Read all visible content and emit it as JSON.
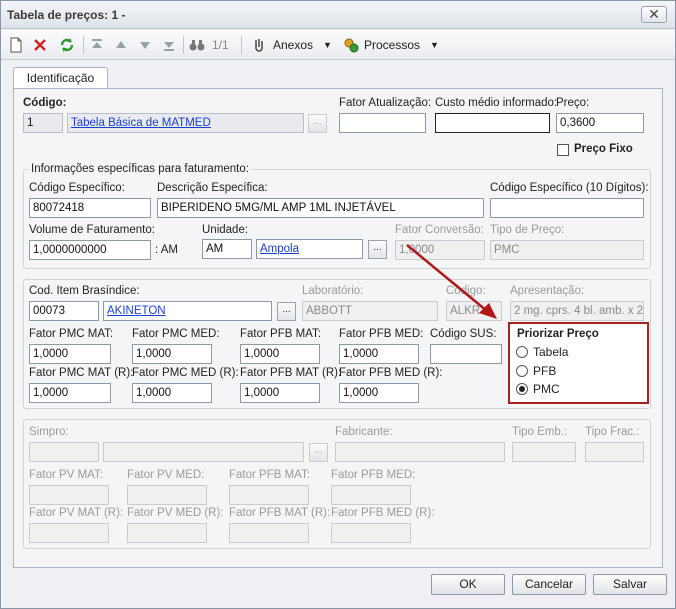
{
  "window": {
    "title": "Tabela de preços: 1 -",
    "close_glyph": "✕"
  },
  "toolbar": {
    "pager": "1/1",
    "anexos": "Anexos",
    "processos": "Processos"
  },
  "tabs": [
    {
      "label": "Identificação"
    }
  ],
  "form": {
    "codigo": {
      "label": "Código:",
      "value": "1",
      "desc": "Tabela Básica de MATMED"
    },
    "fator_atualizacao": {
      "label": "Fator Atualização:",
      "value": ""
    },
    "custo_medio": {
      "label": "Custo médio informado:",
      "value": ""
    },
    "preco": {
      "label": "Preço:",
      "value": "0,3600"
    },
    "preco_fixo": {
      "label": "Preço Fixo",
      "checked": false
    }
  },
  "faturamento": {
    "title": "Informações específicas para faturamento:",
    "codigo_especifico": {
      "label": "Código Específico:",
      "value": "80072418"
    },
    "descricao_especifica": {
      "label": "Descrição Específica:",
      "value": "BIPERIDENO 5MG/ML AMP 1ML INJETÁVEL"
    },
    "codigo_10": {
      "label": "Código Específico (10 Dígitos):",
      "value": ""
    },
    "volume": {
      "label": "Volume de Faturamento:",
      "value": "1,0000000000",
      "suffix": ": AM"
    },
    "unidade": {
      "label": "Unidade:",
      "code": "AM",
      "desc": "Ampola"
    },
    "fator_conversao": {
      "label": "Fator Conversão:",
      "value": "1,0000"
    },
    "tipo_preco": {
      "label": "Tipo de Preço:",
      "value": "PMC"
    }
  },
  "brasindice": {
    "cod_item": {
      "label": "Cod. Item Brasíndice:",
      "code": "00073",
      "desc": "AKINETON"
    },
    "laboratorio": {
      "label": "Laboratório:",
      "value": "ABBOTT"
    },
    "codigo": {
      "label": "Código:",
      "value": "ALKR"
    },
    "apresentacao": {
      "label": "Apresentação:",
      "value": "2 mg. cprs. 4 bl. amb. x 20"
    },
    "row1_labels": [
      "Fator PMC MAT:",
      "Fator PMC MED:",
      "Fator PFB MAT:",
      "Fator PFB MED:",
      "Código SUS:"
    ],
    "row1_values": [
      "1,0000",
      "1,0000",
      "1,0000",
      "1,0000",
      ""
    ],
    "row2_labels": [
      "Fator PMC MAT (R):",
      "Fator PMC MED (R):",
      "Fator PFB MAT (R):",
      "Fator PFB MED (R):"
    ],
    "row2_values": [
      "1,0000",
      "1,0000",
      "1,0000",
      "1,0000"
    ]
  },
  "priorizar": {
    "title": "Priorizar Preço",
    "options": [
      "Tabela",
      "PFB",
      "PMC"
    ],
    "selected": "PMC"
  },
  "simpro": {
    "simpro": {
      "label": "Simpro:"
    },
    "fabricante": {
      "label": "Fabricante:"
    },
    "tipo_emb": {
      "label": "Tipo Emb.:"
    },
    "tipo_frac": {
      "label": "Tipo Frac.:"
    },
    "row1_labels": [
      "Fator PV MAT:",
      "Fator PV MED:",
      "Fator PFB MAT:",
      "Fator PFB MED:"
    ],
    "row2_labels": [
      "Fator PV MAT (R):",
      "Fator PV MED (R):",
      "Fator PFB MAT (R):",
      "Fator PFB MED (R):"
    ]
  },
  "footer": {
    "ok": "OK",
    "cancel": "Cancelar",
    "save": "Salvar"
  },
  "colors": {
    "highlight": "#a82020",
    "link": "#1a3fd0"
  },
  "icons": [
    "new-icon",
    "delete-icon",
    "refresh-icon",
    "first-icon",
    "prev-icon",
    "next-icon",
    "last-icon",
    "find-icon",
    "attachment-icon",
    "process-icon",
    "chevron-down-icon",
    "lookup-icon",
    "annotation-arrow-icon"
  ]
}
